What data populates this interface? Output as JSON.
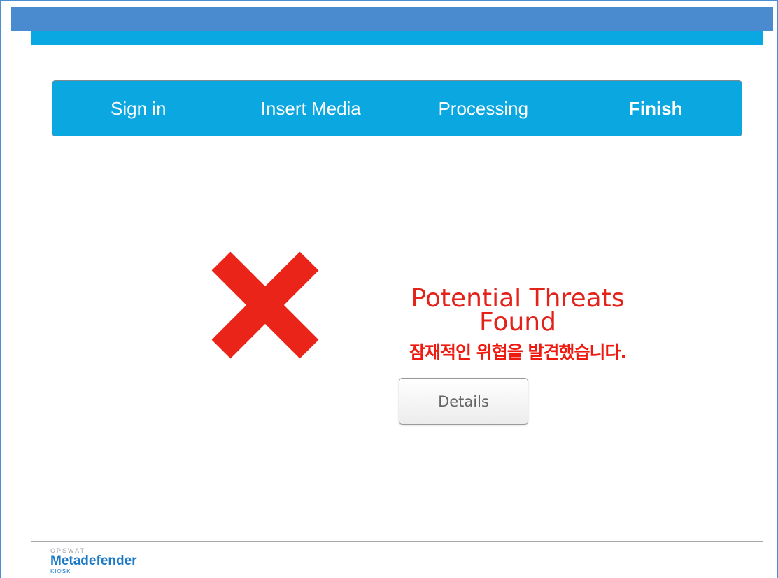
{
  "steps": [
    {
      "label": "Sign in",
      "active": false
    },
    {
      "label": "Insert Media",
      "active": false
    },
    {
      "label": "Processing",
      "active": false
    },
    {
      "label": "Finish",
      "active": true
    }
  ],
  "result": {
    "icon": "x-mark-icon",
    "status_color": "#e3231a",
    "title_line1": "Potential Threats",
    "title_line2": "Found",
    "korean_message": "잠재적인 위협을 발견했습니다.",
    "details_label": "Details"
  },
  "branding": {
    "vendor": "OPSWAT",
    "product": "Metadefender",
    "edition": "KIOSK"
  },
  "colors": {
    "accent": "#0aa8e2",
    "title_bar": "#4a8bcf",
    "threat_red": "#e3231a"
  }
}
